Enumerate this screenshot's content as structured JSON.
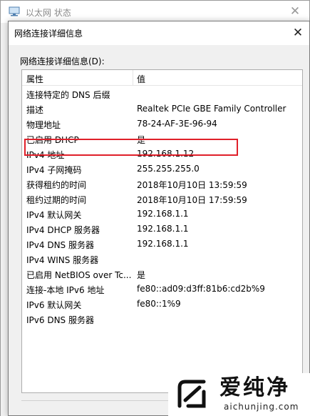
{
  "background_window": {
    "title": "以太网 状态",
    "close_glyph": "✕"
  },
  "dialog": {
    "title": "网络连接详细信息",
    "close_glyph": "✕",
    "list_caption": "网络连接详细信息(D):",
    "columns": {
      "property": "属性",
      "value": "值"
    },
    "rows": [
      {
        "property": "连接特定的 DNS 后缀",
        "value": ""
      },
      {
        "property": "描述",
        "value": "Realtek PCIe GBE Family Controller"
      },
      {
        "property": "物理地址",
        "value": "78-24-AF-3E-96-94"
      },
      {
        "property": "已启用 DHCP",
        "value": "是"
      },
      {
        "property": "IPv4 地址",
        "value": "192.168.1.12"
      },
      {
        "property": "IPv4 子网掩码",
        "value": "255.255.255.0"
      },
      {
        "property": "获得租约的时间",
        "value": "2018年10月10日 13:59:59"
      },
      {
        "property": "租约过期的时间",
        "value": "2018年10月10日 17:59:59"
      },
      {
        "property": "IPv4 默认网关",
        "value": "192.168.1.1"
      },
      {
        "property": "IPv4 DHCP 服务器",
        "value": "192.168.1.1"
      },
      {
        "property": "IPv4 DNS 服务器",
        "value": "192.168.1.1"
      },
      {
        "property": "IPv4 WINS 服务器",
        "value": ""
      },
      {
        "property": "已启用 NetBIOS over Tc...",
        "value": "是"
      },
      {
        "property": "连接-本地 IPv6 地址",
        "value": "fe80::ad09:d3ff:81b6:cd2b%9"
      },
      {
        "property": "IPv6 默认网关",
        "value": "fe80::1%9"
      },
      {
        "property": "IPv6 DNS 服务器",
        "value": ""
      }
    ],
    "highlighted_row": "物理地址",
    "highlight_color": "#e0202a"
  },
  "watermark": {
    "brand": "爱纯净",
    "url": "aichunjing.com"
  }
}
